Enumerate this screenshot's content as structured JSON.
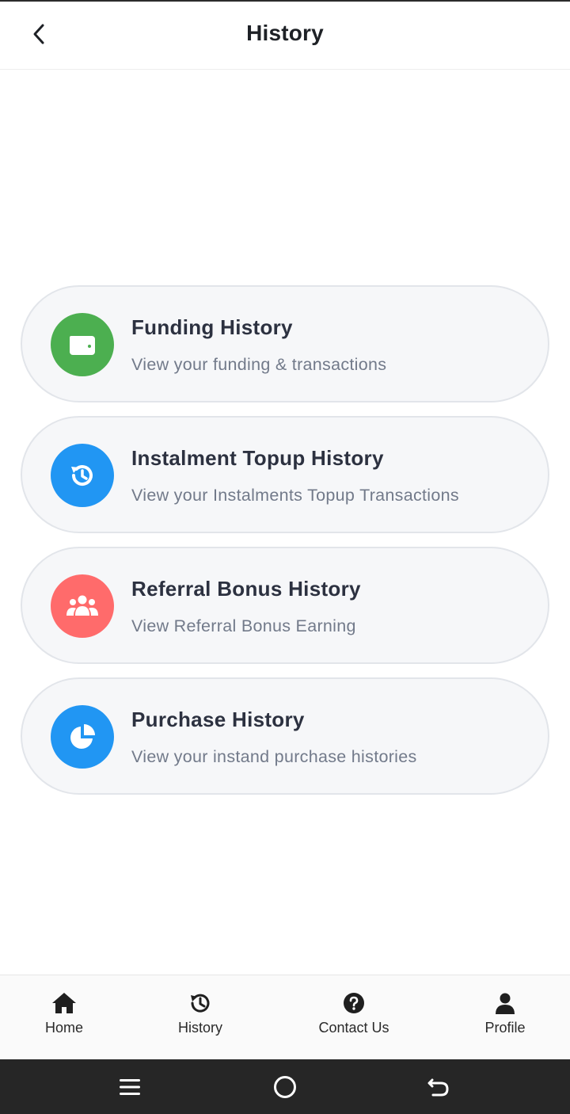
{
  "header": {
    "title": "History"
  },
  "menu": [
    {
      "title": "Funding History",
      "subtitle": "View your funding & transactions",
      "icon": "wallet-icon",
      "color": "#4caf50"
    },
    {
      "title": "Instalment Topup History",
      "subtitle": "View your Instalments Topup Transactions",
      "icon": "history-icon",
      "color": "#2196f3"
    },
    {
      "title": "Referral Bonus History",
      "subtitle": "View Referral Bonus Earning",
      "icon": "users-icon",
      "color": "#ff6b6b"
    },
    {
      "title": "Purchase History",
      "subtitle": "View your instand purchase histories",
      "icon": "pie-chart-icon",
      "color": "#2196f3"
    }
  ],
  "bottom_nav": [
    {
      "label": "Home",
      "icon": "home-icon"
    },
    {
      "label": "History",
      "icon": "history-icon"
    },
    {
      "label": "Contact Us",
      "icon": "help-icon"
    },
    {
      "label": "Profile",
      "icon": "person-icon"
    }
  ],
  "system_nav": {
    "icons": [
      "recents-icon",
      "home-circle-icon",
      "back-icon"
    ]
  }
}
